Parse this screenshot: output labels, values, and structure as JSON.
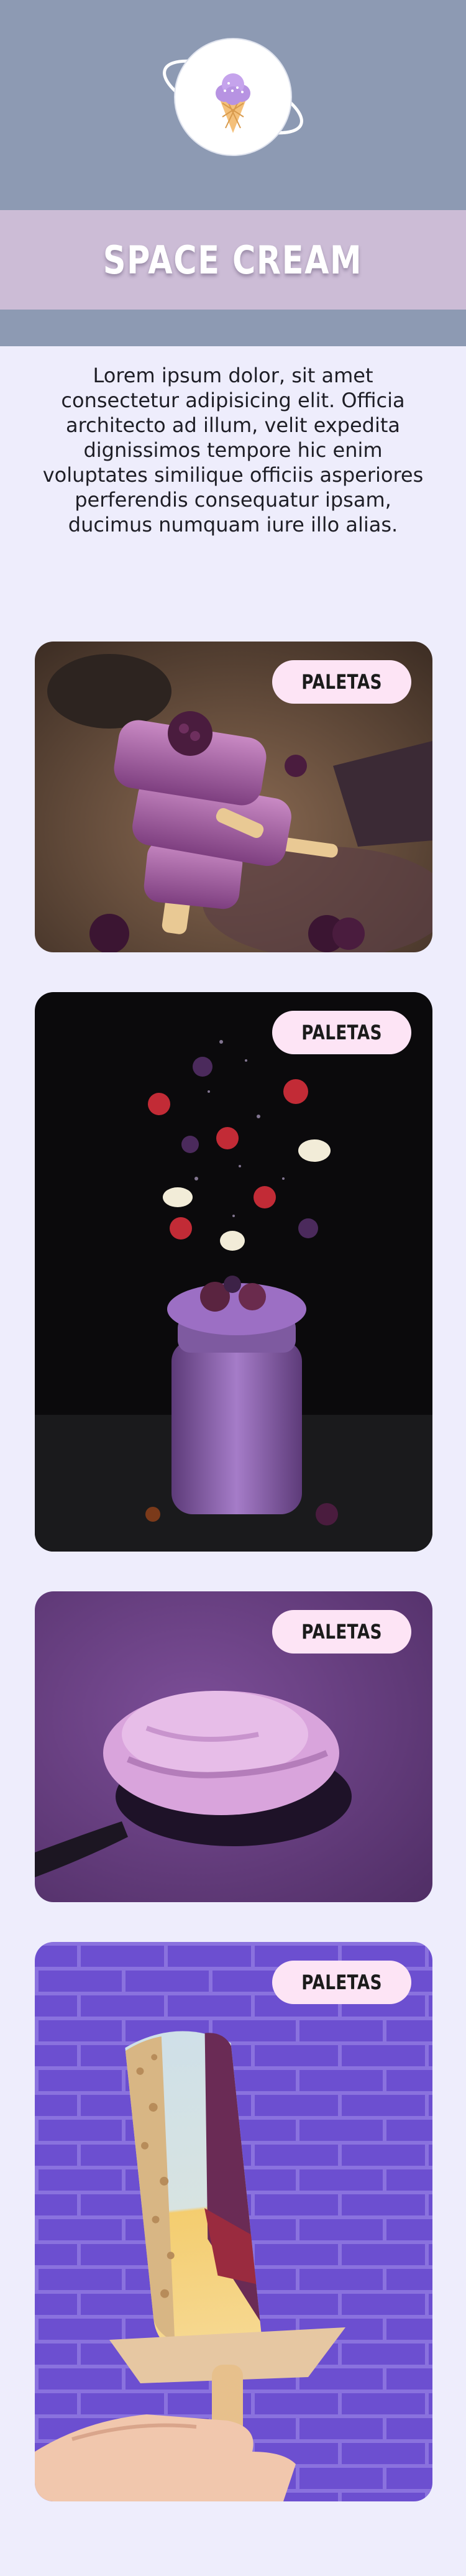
{
  "brand": {
    "title": "SPACE CREAM",
    "logo_icon": "ice-cream-planet-icon",
    "colors": {
      "header": "#8d9ab3",
      "title_band": "#ccbcd6",
      "background": "#eeedfc",
      "badge": "#fde4f5"
    }
  },
  "intro": {
    "text": "Lorem ipsum dolor, sit amet consectetur adipisicing elit. Officia architecto ad illum, velit expedita dignissimos tempore hic enim voluptates similique officiis asperiores perferendis consequatur ipsam, ducimus numquam iure illo alias."
  },
  "cards": [
    {
      "badge": "PALETAS",
      "image": "stacked-berry-popsicles-photo"
    },
    {
      "badge": "PALETAS",
      "image": "berry-smoothie-jar-photo"
    },
    {
      "badge": "PALETAS",
      "image": "purple-ice-cream-spoon-photo"
    },
    {
      "badge": "PALETAS",
      "image": "layered-nut-popsicle-photo"
    }
  ]
}
